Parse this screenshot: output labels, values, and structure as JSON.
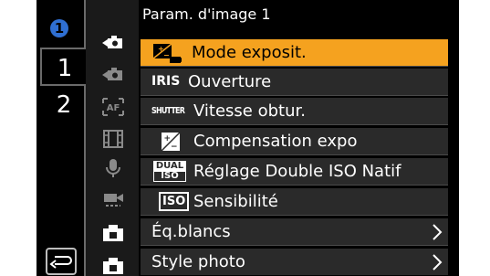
{
  "screen": {
    "badge_number": "1",
    "pages": [
      {
        "label": "1"
      },
      {
        "label": "2"
      }
    ]
  },
  "header": {
    "title": "Param. d'image 1"
  },
  "categories": [
    {
      "icon": "photo-camera-icon"
    },
    {
      "icon": "photo-camera-dim-icon"
    },
    {
      "icon": "af-icon"
    },
    {
      "icon": "film-icon"
    },
    {
      "icon": "microphone-icon"
    },
    {
      "icon": "video-camera-icon"
    },
    {
      "icon": "camera-body-icon"
    },
    {
      "icon": "camera-body-icon"
    }
  ],
  "menu": {
    "items": [
      {
        "label": "Mode exposit.",
        "icon": "exposure-mode-icon",
        "icon_text": ""
      },
      {
        "label": "Ouverture",
        "icon": "iris-icon",
        "icon_text": "IRIS"
      },
      {
        "label": "Vitesse obtur.",
        "icon": "shutter-icon",
        "icon_text": "SHUTTER"
      },
      {
        "label": "Compensation expo",
        "icon": "exposure-compensation-icon",
        "icon_text": ""
      },
      {
        "label": "Réglage Double ISO Natif",
        "icon": "dual-iso-icon",
        "icon_text_1": "DUAL",
        "icon_text_2": "ISO"
      },
      {
        "label": "Sensibilité",
        "icon": "iso-icon",
        "icon_text": "ISO"
      },
      {
        "label": "Éq.blancs",
        "icon": "",
        "icon_text": ""
      },
      {
        "label": "Style photo",
        "icon": "",
        "icon_text": ""
      }
    ]
  },
  "colors": {
    "selected": "#f5a21f",
    "badge": "#2f6fd2",
    "row": "#2a2a2a",
    "background": "#000000"
  }
}
